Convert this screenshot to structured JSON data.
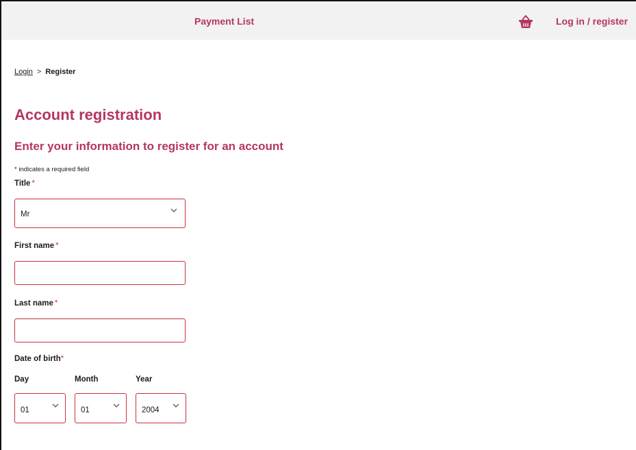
{
  "header": {
    "payment_list_label": "Payment List",
    "login_register_label": "Log in / register",
    "basket_icon": "basket-icon"
  },
  "breadcrumb": {
    "login_label": "Login",
    "separator": ">",
    "current_label": "Register"
  },
  "page": {
    "title": "Account registration",
    "subtitle": "Enter your information to register for an account",
    "required_note": "* indicates a required field",
    "required_marker": "*"
  },
  "form": {
    "title_label": "Title",
    "title_value": "Mr",
    "first_name_label": "First name",
    "first_name_value": "",
    "last_name_label": "Last name",
    "last_name_value": "",
    "dob_label": "Date of birth",
    "day_label": "Day",
    "month_label": "Month",
    "year_label": "Year",
    "day_value": "01",
    "month_value": "01",
    "year_value": "2004"
  },
  "colors": {
    "accent": "#b5365f",
    "error_border": "#c8303c",
    "header_bg": "#f2f2f2"
  }
}
